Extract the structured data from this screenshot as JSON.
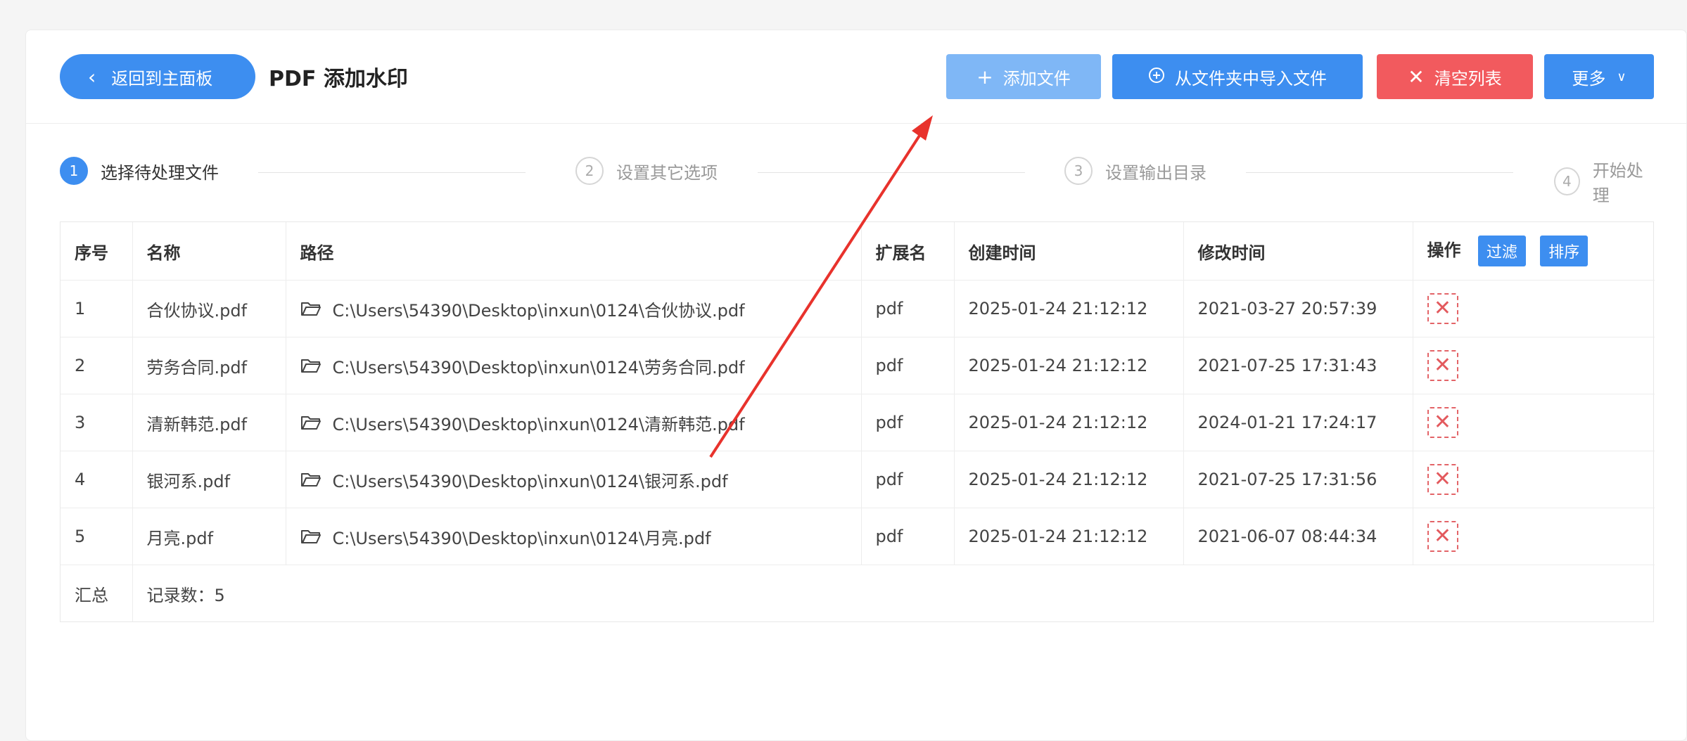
{
  "header": {
    "back_label": "返回到主面板",
    "title": "PDF 添加水印",
    "buttons": {
      "add": "添加文件",
      "import": "从文件夹中导入文件",
      "clear": "清空列表",
      "more": "更多"
    }
  },
  "steps": [
    {
      "num": "1",
      "label": "选择待处理文件",
      "active": true
    },
    {
      "num": "2",
      "label": "设置其它选项",
      "active": false
    },
    {
      "num": "3",
      "label": "设置输出目录",
      "active": false
    },
    {
      "num": "4",
      "label": "开始处理",
      "active": false
    }
  ],
  "table": {
    "columns": {
      "index": "序号",
      "name": "名称",
      "path": "路径",
      "ext": "扩展名",
      "created": "创建时间",
      "modified": "修改时间",
      "actions": "操作"
    },
    "filter_label": "过滤",
    "sort_label": "排序",
    "rows": [
      {
        "index": "1",
        "name": "合伙协议.pdf",
        "path": "C:\\Users\\54390\\Desktop\\inxun\\0124\\合伙协议.pdf",
        "ext": "pdf",
        "created": "2025-01-24 21:12:12",
        "modified": "2021-03-27 20:57:39"
      },
      {
        "index": "2",
        "name": "劳务合同.pdf",
        "path": "C:\\Users\\54390\\Desktop\\inxun\\0124\\劳务合同.pdf",
        "ext": "pdf",
        "created": "2025-01-24 21:12:12",
        "modified": "2021-07-25 17:31:43"
      },
      {
        "index": "3",
        "name": "清新韩范.pdf",
        "path": "C:\\Users\\54390\\Desktop\\inxun\\0124\\清新韩范.pdf",
        "ext": "pdf",
        "created": "2025-01-24 21:12:12",
        "modified": "2024-01-21 17:24:17"
      },
      {
        "index": "4",
        "name": "银河系.pdf",
        "path": "C:\\Users\\54390\\Desktop\\inxun\\0124\\银河系.pdf",
        "ext": "pdf",
        "created": "2025-01-24 21:12:12",
        "modified": "2021-07-25 17:31:56"
      },
      {
        "index": "5",
        "name": "月亮.pdf",
        "path": "C:\\Users\\54390\\Desktop\\inxun\\0124\\月亮.pdf",
        "ext": "pdf",
        "created": "2025-01-24 21:12:12",
        "modified": "2021-06-07 08:44:34"
      }
    ],
    "summary_label": "汇总",
    "summary_value": "记录数：5"
  },
  "colors": {
    "primary": "#3d8ef0",
    "primary_light": "#7fb7f6",
    "danger": "#f25a5e",
    "annotation_arrow": "#e8322c"
  },
  "icons": [
    "chevron-left-icon",
    "plus-icon",
    "circle-plus-icon",
    "close-icon",
    "chevron-down-icon",
    "folder-icon",
    "delete-icon"
  ]
}
